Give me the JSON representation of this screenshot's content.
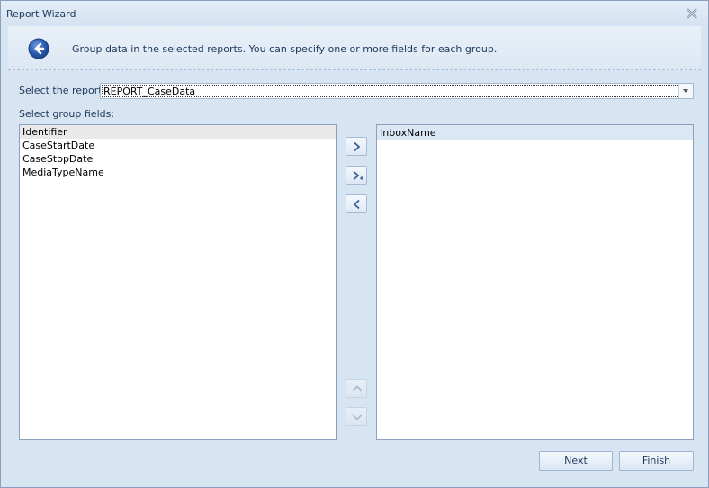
{
  "window": {
    "title": "Report Wizard"
  },
  "header": {
    "text": "Group data in the selected reports. You can specify one or more fields for each group."
  },
  "report_select": {
    "label": "Select the report:",
    "value": "REPORT_CaseData"
  },
  "group_fields": {
    "label": "Select group fields:",
    "available": [
      "Identifier",
      "CaseStartDate",
      "CaseStopDate",
      "MediaTypeName"
    ],
    "selected": [
      "InboxName"
    ]
  },
  "buttons": {
    "next": "Next",
    "finish": "Finish"
  },
  "icons": {
    "close": "close-icon",
    "back": "back-arrow-icon",
    "move_right": "chevron-right-icon",
    "add": "chevron-right-plus-icon",
    "move_left": "chevron-left-icon",
    "move_up": "chevron-up-icon",
    "move_down": "chevron-down-icon"
  },
  "colors": {
    "background": "#d7e4f2",
    "accent": "#2a63b3",
    "text": "#1e395b"
  }
}
